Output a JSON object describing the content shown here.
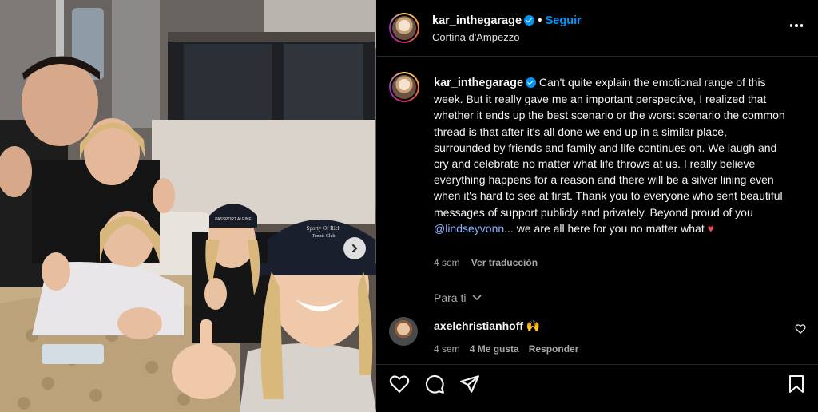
{
  "post": {
    "author": "kar_inthegarage",
    "follow_label": "Seguir",
    "location": "Cortina d'Ampezzo",
    "caption_author": "kar_inthegarage",
    "caption_text": "Can't quite explain the emotional range of this week. But it really gave me an important perspective, I realized that whether it ends up the best scenario or the worst scenario the common thread is that after it's all done we end up in a similar place, surrounded by friends and family and life continues on. We laugh and cry and celebrate no matter what life throws at us. I really believe everything happens for a reason and there will be a silver lining even when it's hard to see at first. Thank you to everyone who sent beautiful messages of support publicly and privately. Beyond proud of you",
    "caption_mention": "@lindseyvonn",
    "caption_tail": "... we are all here for you no matter what",
    "caption_emoji": "♥",
    "time_ago": "4 sem",
    "translate_label": "Ver traducción"
  },
  "comments_filter": "Para ti",
  "comment": {
    "author": "axelchristianhoff",
    "text": "🙌",
    "time_ago": "4 sem",
    "likes": "4 Me gusta",
    "reply_label": "Responder"
  },
  "photo": {
    "cap_text_1": "Sporty Of Rich",
    "cap_text_2": "Tennis Club",
    "cap2_text": "PASSPORT ALPINE"
  },
  "icons": [
    "verified-badge-icon",
    "more-options-icon",
    "chevron-right-icon",
    "chevron-down-icon",
    "heart-icon",
    "comment-icon",
    "share-icon",
    "bookmark-icon"
  ]
}
